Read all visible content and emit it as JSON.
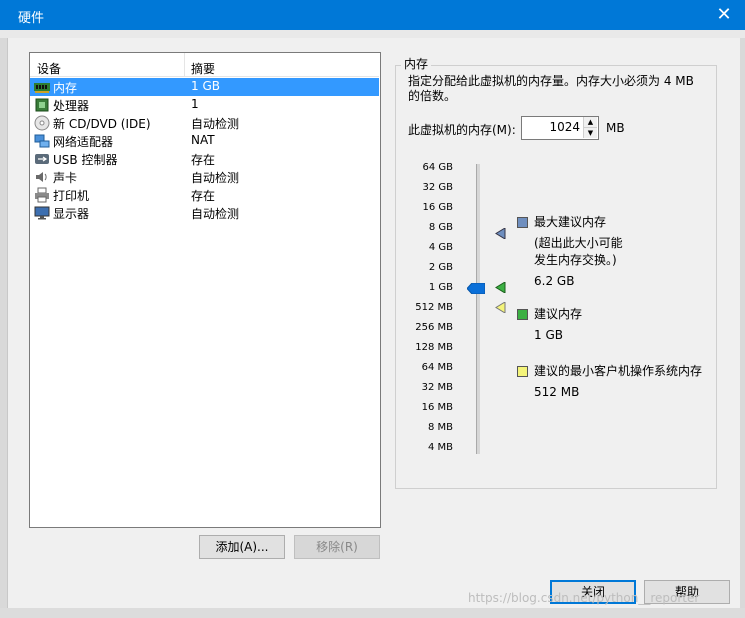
{
  "window": {
    "title": "硬件",
    "close_glyph": "✕"
  },
  "device_table": {
    "headers": {
      "device": "设备",
      "summary": "摘要"
    },
    "rows": [
      {
        "name": "内存",
        "summary": "1 GB",
        "icon": "memory-icon",
        "selected": true
      },
      {
        "name": "处理器",
        "summary": "1",
        "icon": "processor-icon"
      },
      {
        "name": "新 CD/DVD (IDE)",
        "summary": "自动检测",
        "icon": "cd-dvd-icon"
      },
      {
        "name": "网络适配器",
        "summary": "NAT",
        "icon": "network-adapter-icon"
      },
      {
        "name": "USB 控制器",
        "summary": "存在",
        "icon": "usb-icon"
      },
      {
        "name": "声卡",
        "summary": "自动检测",
        "icon": "sound-card-icon"
      },
      {
        "name": "打印机",
        "summary": "存在",
        "icon": "printer-icon"
      },
      {
        "name": "显示器",
        "summary": "自动检测",
        "icon": "display-icon"
      }
    ]
  },
  "buttons": {
    "add": "添加(A)...",
    "remove": "移除(R)",
    "close": "关闭",
    "help": "帮助"
  },
  "memory": {
    "group_title": "内存",
    "description": "指定分配给此虚拟机的内存量。内存大小必须为 4 MB 的倍数。",
    "description_line1": "指定分配给此虚拟机的内存量。内存大小必须为 4 MB",
    "description_line2": "的倍数。",
    "field_label": "此虚拟机的内存(M):",
    "value": "1024",
    "unit": "MB",
    "slider_ticks": [
      "64 GB",
      "32 GB",
      "16 GB",
      "8 GB",
      "4 GB",
      "2 GB",
      "1 GB",
      "512 MB",
      "256 MB",
      "128 MB",
      "64 MB",
      "32 MB",
      "16 MB",
      "8 MB",
      "4 MB"
    ],
    "slider_value": "1 GB",
    "max_recommended": {
      "label": "最大建议内存",
      "note_line1": "(超出此大小可能",
      "note_line2": "发生内存交换。)",
      "value": "6.2 GB",
      "color": "#6f8fbf"
    },
    "recommended": {
      "label": "建议内存",
      "value": "1 GB",
      "color": "#3cb043"
    },
    "guest_min": {
      "label": "建议的最小客户机操作系统内存",
      "value": "512 MB",
      "color": "#f4f47a"
    }
  },
  "watermark": "https://blog.csdn.net/python__reporter",
  "colors": {
    "titlebar": "#0078d7",
    "selection": "#3399ff",
    "slider_thumb": "#0a6fd8"
  }
}
